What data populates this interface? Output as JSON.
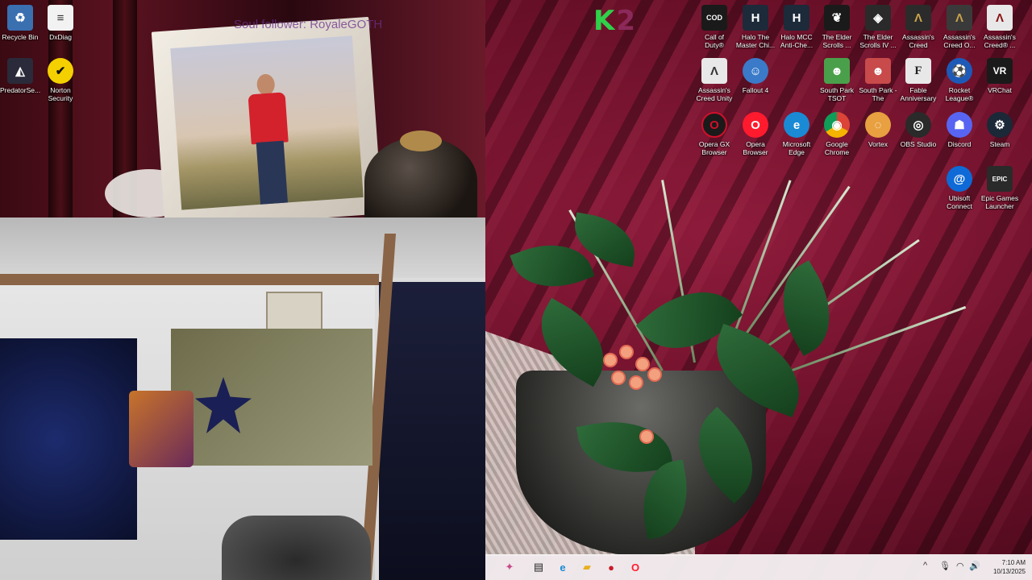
{
  "desktop": {
    "overlay_text": "Soul follower: RoyaleGOTH",
    "logo": {
      "k": "K",
      "two": "2"
    },
    "icons": [
      {
        "id": "recycle-bin",
        "label": "Recycle Bin",
        "glyph": "♻",
        "color": "#3a6fb0"
      },
      {
        "id": "dxdiag",
        "label": "DxDiag",
        "glyph": "≡",
        "color": "#f2f2f2"
      },
      {
        "id": "predator-sense",
        "label": "PredatorSe...",
        "glyph": "◭",
        "color": "#2a2a3a"
      },
      {
        "id": "norton",
        "label": "Norton Security Ultra",
        "glyph": "✔",
        "color": "#f5d000"
      },
      {
        "id": "call-of-duty",
        "label": "Call of Duty®",
        "glyph": "COD",
        "color": "#1a1a1a"
      },
      {
        "id": "halo-mcc",
        "label": "Halo The Master Chi...",
        "glyph": "H",
        "color": "#1c2a3a"
      },
      {
        "id": "halo-mcc-ac",
        "label": "Halo MCC Anti-Che...",
        "glyph": "H",
        "color": "#1c2a3a"
      },
      {
        "id": "elder-scrolls-online",
        "label": "The Elder Scrolls ...",
        "glyph": "❦",
        "color": "#1a1a1a"
      },
      {
        "id": "elder-scrolls-4",
        "label": "The Elder Scrolls IV ...",
        "glyph": "◈",
        "color": "#2a2a2a"
      },
      {
        "id": "ac-mirage",
        "label": "Assassin's Creed Mirage",
        "glyph": "Λ",
        "color": "#2b2b2b"
      },
      {
        "id": "ac-odyssey",
        "label": "Assassin's Creed O...",
        "glyph": "Λ",
        "color": "#3a3a3a"
      },
      {
        "id": "ac-original",
        "label": "Assassin's Creed® ...",
        "glyph": "Λ",
        "color": "#e8e8e8"
      },
      {
        "id": "ac-unity",
        "label": "Assassin's Creed Unity",
        "glyph": "Λ",
        "color": "#e8e8e8"
      },
      {
        "id": "fallout-4",
        "label": "Fallout 4",
        "glyph": "☺",
        "color": "#3a7ac8"
      },
      {
        "id": "south-park-tsot",
        "label": "South Park TSOT",
        "glyph": "☻",
        "color": "#4aa04a"
      },
      {
        "id": "south-park-fb",
        "label": "South Park - The Fractur...",
        "glyph": "☻",
        "color": "#c84a4a"
      },
      {
        "id": "fable",
        "label": "Fable Anniversary",
        "glyph": "F",
        "color": "#e8e8e8"
      },
      {
        "id": "rocket-league",
        "label": "Rocket League®",
        "glyph": "⚽",
        "color": "#1d5ab8"
      },
      {
        "id": "vrchat",
        "label": "VRChat",
        "glyph": "VR",
        "color": "#1a1a1a"
      },
      {
        "id": "opera-gx",
        "label": "Opera GX Browser",
        "glyph": "O",
        "color": "#d0102a"
      },
      {
        "id": "opera",
        "label": "Opera Browser",
        "glyph": "O",
        "color": "#ff1b2d"
      },
      {
        "id": "edge",
        "label": "Microsoft Edge",
        "glyph": "e",
        "color": "#1a8ad4"
      },
      {
        "id": "chrome",
        "label": "Google Chrome",
        "glyph": "◉",
        "color": "#e2a017"
      },
      {
        "id": "vortex",
        "label": "Vortex",
        "glyph": "◌",
        "color": "#e8a040"
      },
      {
        "id": "obs",
        "label": "OBS Studio",
        "glyph": "◎",
        "color": "#2a2a2a"
      },
      {
        "id": "discord",
        "label": "Discord",
        "glyph": "☗",
        "color": "#5865f2"
      },
      {
        "id": "steam",
        "label": "Steam",
        "glyph": "⚙",
        "color": "#1b2838"
      },
      {
        "id": "ubisoft",
        "label": "Ubisoft Connect",
        "glyph": "@",
        "color": "#0e6ad6"
      },
      {
        "id": "epic",
        "label": "Epic Games Launcher",
        "glyph": "EPIC",
        "color": "#2a2a2a"
      }
    ]
  },
  "taskbar": {
    "apps": [
      {
        "id": "start",
        "glyph": "✦",
        "color": "#c84a8a"
      },
      {
        "id": "task-view",
        "glyph": "▤",
        "color": "#222"
      },
      {
        "id": "edge",
        "glyph": "e",
        "color": "#1a8ad4"
      },
      {
        "id": "file-explorer",
        "glyph": "▰",
        "color": "#e8b020"
      },
      {
        "id": "media-app",
        "glyph": "●",
        "color": "#c81a2a"
      },
      {
        "id": "opera",
        "glyph": "O",
        "color": "#ff1b2d"
      }
    ],
    "tray": {
      "chevron": "^",
      "mic": "🎙",
      "wifi": "◠",
      "volume": "🔊"
    },
    "time": "7:10 AM",
    "date": "10/13/2025"
  }
}
